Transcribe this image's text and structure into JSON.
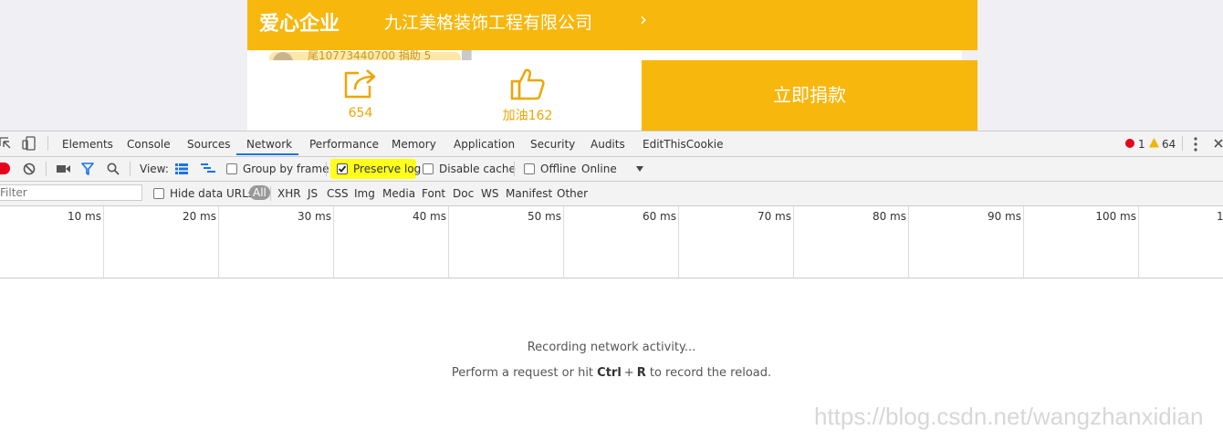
{
  "page": {
    "brand": "爱心企业",
    "company": "九江美格装饰工程有限公司",
    "chevron": "›",
    "donor_text": "尾10773440700   捐助 5",
    "share_count": "654",
    "like_label": "加油162",
    "donate_label": "立即捐款"
  },
  "devtools": {
    "tabs": [
      "Elements",
      "Console",
      "Sources",
      "Network",
      "Performance",
      "Memory",
      "Application",
      "Security",
      "Audits",
      "EditThisCookie"
    ],
    "active_tab": "Network",
    "errors": "1",
    "warnings": "64",
    "toolbar": {
      "view_label": "View:",
      "group_by_frame": "Group by frame",
      "preserve_log": "Preserve log",
      "preserve_log_checked": true,
      "disable_cache": "Disable cache",
      "offline": "Offline",
      "throttle": "Online"
    },
    "filter": {
      "placeholder": "Filter",
      "hide_data_urls": "Hide data URLs",
      "types": [
        "All",
        "XHR",
        "JS",
        "CSS",
        "Img",
        "Media",
        "Font",
        "Doc",
        "WS",
        "Manifest",
        "Other"
      ]
    },
    "timeline_ticks": [
      "10 ms",
      "20 ms",
      "30 ms",
      "40 ms",
      "50 ms",
      "60 ms",
      "70 ms",
      "80 ms",
      "90 ms",
      "100 ms",
      "1"
    ],
    "empty": {
      "line1": "Recording network activity...",
      "line2_prefix": "Perform a request or hit ",
      "key1": "Ctrl",
      "plus": "+",
      "key2": "R",
      "line2_suffix": " to record the reload."
    },
    "watermark": "https://blog.csdn.net/wangzhanxidian"
  },
  "colors": {
    "brand": "#f8b70d",
    "accent": "#1a73e8",
    "record": "#e8001c"
  }
}
